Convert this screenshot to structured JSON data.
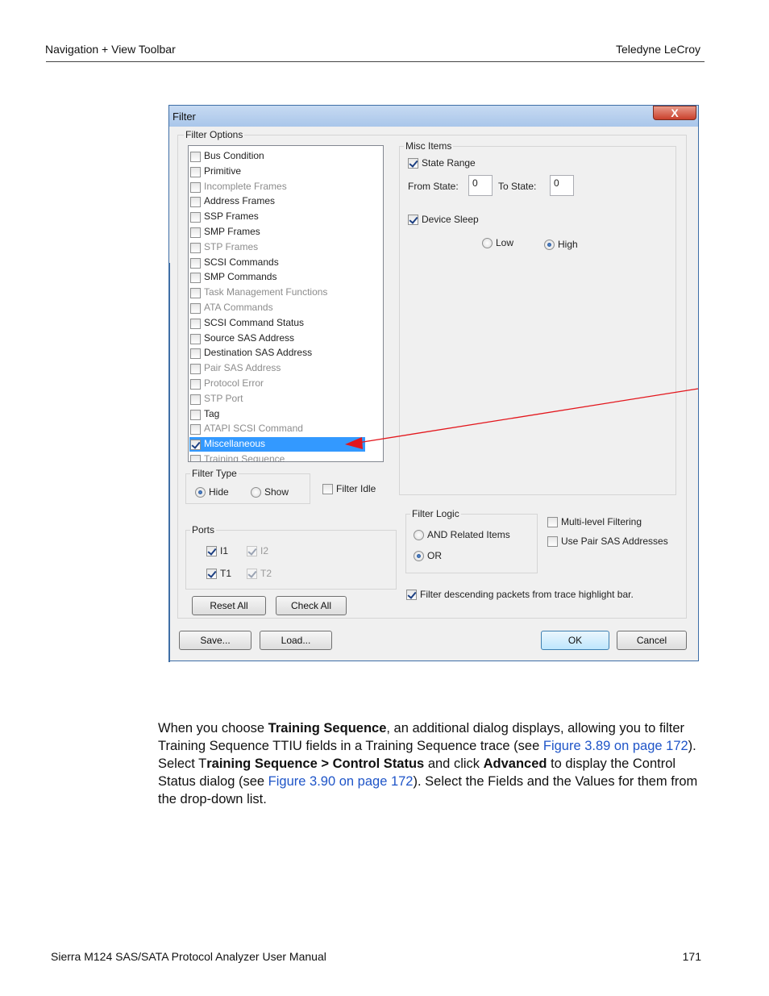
{
  "page": {
    "header_left": "Navigation + View Toolbar",
    "header_right": "Teledyne LeCroy",
    "footer_left": "Sierra M124 SAS/SATA Protocol Analyzer User Manual",
    "footer_right": "171"
  },
  "dialog": {
    "title": "Filter",
    "close_glyph": "X",
    "filter_options_caption": "Filter Options",
    "list_items": [
      {
        "label": "Bus Condition",
        "checked": false,
        "enabled": true
      },
      {
        "label": "Primitive",
        "checked": false,
        "enabled": true
      },
      {
        "label": "Incomplete Frames",
        "checked": false,
        "enabled": false
      },
      {
        "label": "Address Frames",
        "checked": false,
        "enabled": true
      },
      {
        "label": "SSP Frames",
        "checked": false,
        "enabled": true
      },
      {
        "label": "SMP Frames",
        "checked": false,
        "enabled": true
      },
      {
        "label": "STP Frames",
        "checked": false,
        "enabled": false
      },
      {
        "label": "SCSI Commands",
        "checked": false,
        "enabled": true
      },
      {
        "label": "SMP Commands",
        "checked": false,
        "enabled": true
      },
      {
        "label": "Task Management Functions",
        "checked": false,
        "enabled": false
      },
      {
        "label": "ATA Commands",
        "checked": false,
        "enabled": false
      },
      {
        "label": "SCSI Command Status",
        "checked": false,
        "enabled": true
      },
      {
        "label": "Source SAS Address",
        "checked": false,
        "enabled": true
      },
      {
        "label": "Destination SAS Address",
        "checked": false,
        "enabled": true
      },
      {
        "label": "Pair SAS Address",
        "checked": false,
        "enabled": false
      },
      {
        "label": "Protocol Error",
        "checked": false,
        "enabled": false
      },
      {
        "label": "STP Port",
        "checked": false,
        "enabled": false
      },
      {
        "label": "Tag",
        "checked": false,
        "enabled": true
      },
      {
        "label": "ATAPI SCSI Command",
        "checked": false,
        "enabled": false
      },
      {
        "label": "Miscellaneous",
        "checked": true,
        "enabled": true,
        "selected": true
      },
      {
        "label": "Training Sequence",
        "checked": false,
        "enabled": false
      }
    ],
    "filter_type": {
      "caption": "Filter Type",
      "hide": "Hide",
      "show": "Show",
      "selected": "hide"
    },
    "filter_idle": "Filter Idle",
    "ports": {
      "caption": "Ports",
      "i1": "I1",
      "i2": "I2",
      "t1": "T1",
      "t2": "T2"
    },
    "reset_all": "Reset All",
    "check_all": "Check All",
    "misc_items": {
      "caption": "Misc Items",
      "state_range": "State Range",
      "from_state_label": "From State:",
      "from_state_value": "0",
      "to_state_label": "To State:",
      "to_state_value": "0",
      "device_sleep": "Device Sleep",
      "low": "Low",
      "high": "High",
      "selected": "high"
    },
    "filter_logic": {
      "caption": "Filter Logic",
      "and_related": "AND Related Items",
      "or": "OR",
      "selected": "or"
    },
    "multi_level": "Multi-level Filtering",
    "use_pair_sas": "Use Pair SAS Addresses",
    "filter_descending": "Filter descending packets from trace highlight bar.",
    "save": "Save...",
    "load": "Load...",
    "ok": "OK",
    "cancel": "Cancel"
  },
  "annotation": {
    "arrow_color": "#e3161c"
  },
  "body": {
    "s1": "When you choose ",
    "b1": "Training Sequence",
    "s2": ", an additional dialog displays, allowing you to filter Training Sequence TTIU fields in a Training Sequence trace (see ",
    "link1": "Figure 3.89 on page 172",
    "s3": "). Select T",
    "b2": "raining Sequence > Control Status",
    "s4": " and click ",
    "b3": "Advanced",
    "s5": " to display the Control Status dialog (see ",
    "link2": "Figure 3.90 on page 172",
    "s6": "). Select the Fields and the Values for them from the drop-down list."
  }
}
